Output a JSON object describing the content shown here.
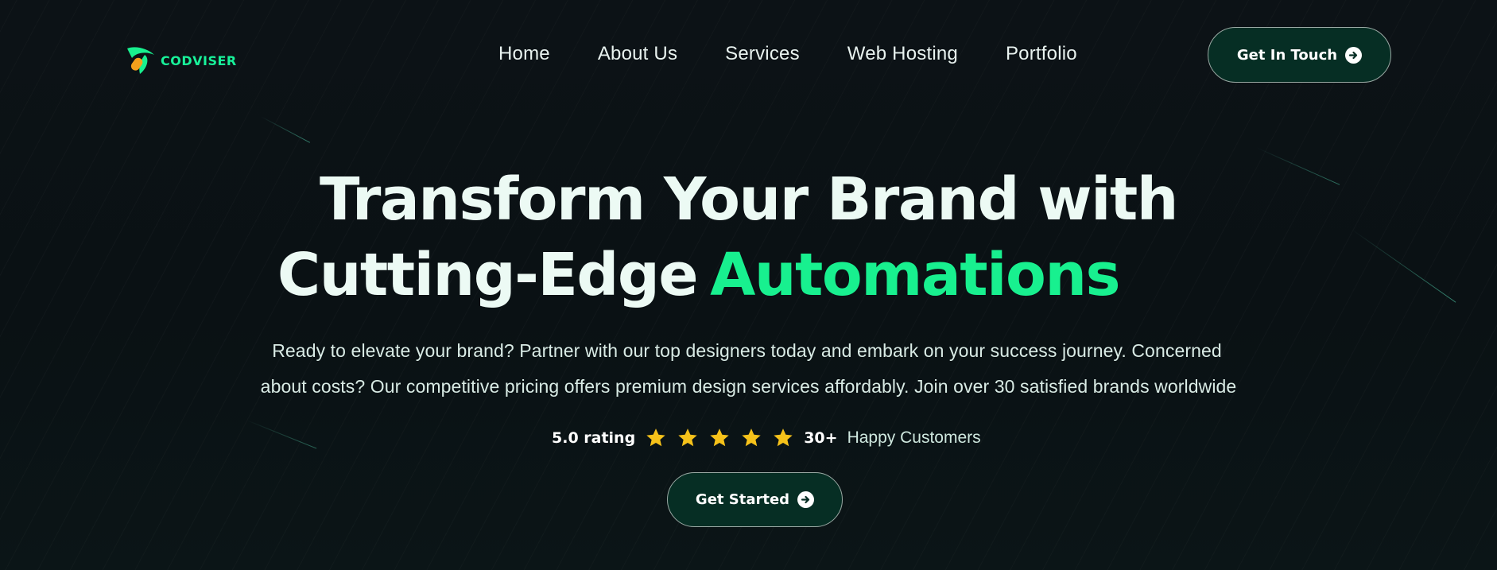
{
  "brand": {
    "name": "CODVISER",
    "colors": {
      "accent": "#18f08f",
      "orange": "#f4a01c",
      "button_bg": "#062e24",
      "star": "#f6c21a"
    }
  },
  "nav": {
    "items": [
      {
        "label": "Home"
      },
      {
        "label": "About Us"
      },
      {
        "label": "Services"
      },
      {
        "label": "Web Hosting"
      },
      {
        "label": "Portfolio"
      }
    ],
    "cta_label": "Get In Touch",
    "cta_icon": "arrow-right-circle-icon"
  },
  "hero": {
    "headline_line1": "Transform Your Brand with",
    "headline_line2": "Cutting-Edge",
    "headline_highlight": "Automations",
    "description_line1": "Ready to elevate your brand? Partner with our top designers today and embark on your success journey. Concerned",
    "description_line2": "about costs? Our competitive pricing offers premium design services affordably. Join over 30 satisfied brands worldwide",
    "rating_text": "5.0 rating",
    "rating_stars": 5,
    "customers_count": "30+",
    "customers_label": "Happy Customers",
    "cta_label": "Get Started",
    "cta_icon": "arrow-right-circle-icon"
  }
}
